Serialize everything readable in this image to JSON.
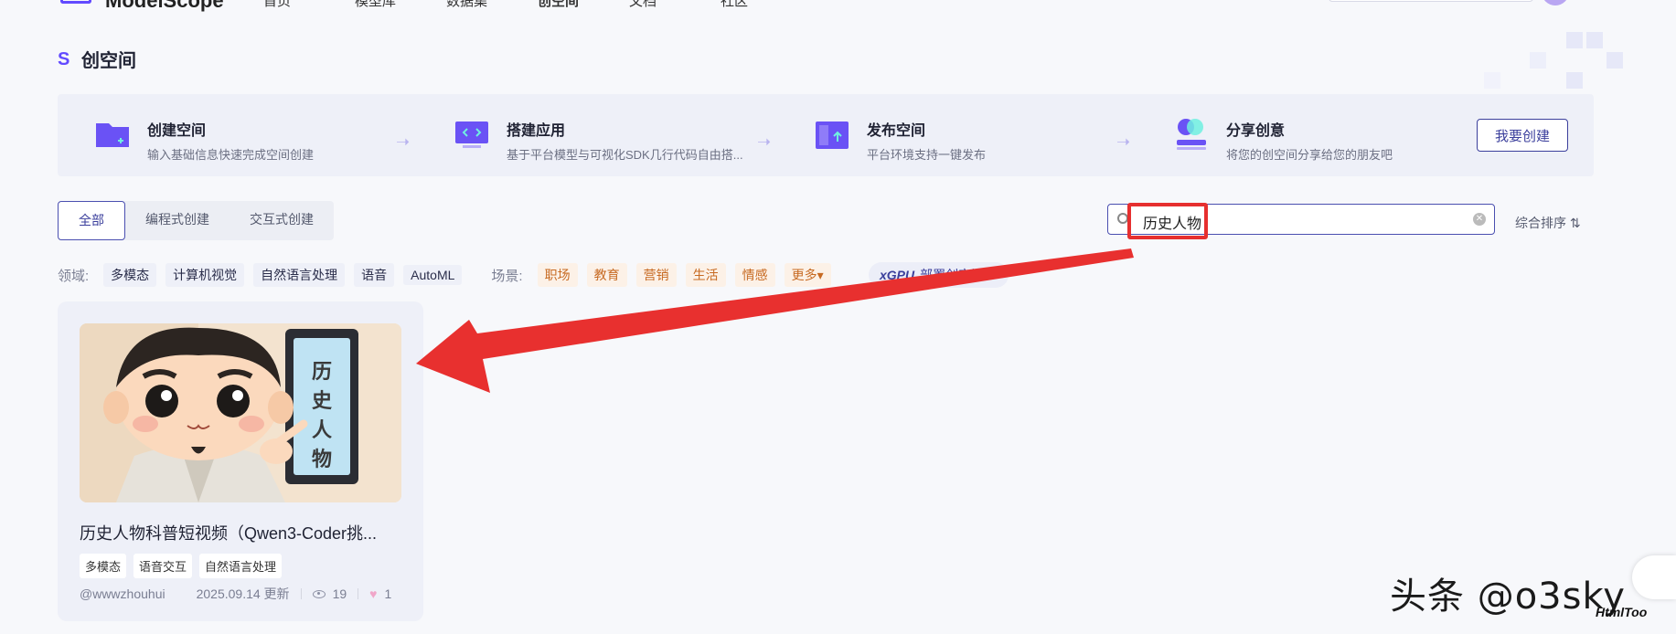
{
  "nav": {
    "logo": "ModelScope",
    "items": [
      "首页",
      "模型库",
      "数据集",
      "创空间",
      "文档",
      "社区"
    ],
    "active_index": 3
  },
  "page": {
    "title": "创空间"
  },
  "steps": [
    {
      "title": "创建空间",
      "desc": "输入基础信息快速完成空间创建",
      "icon": "folder-plus-icon"
    },
    {
      "title": "搭建应用",
      "desc": "基于平台模型与可视化SDK几行代码自由搭...",
      "icon": "code-window-icon"
    },
    {
      "title": "发布空间",
      "desc": "平台环境支持一键发布",
      "icon": "upload-icon"
    },
    {
      "title": "分享创意",
      "desc": "将您的创空间分享给您的朋友吧",
      "icon": "user-share-icon"
    }
  ],
  "create_button": "我要创建",
  "tabs": [
    {
      "label": "全部",
      "active": true
    },
    {
      "label": "编程式创建",
      "active": false
    },
    {
      "label": "交互式创建",
      "active": false
    }
  ],
  "search": {
    "value": "历史人物"
  },
  "sort_label": "综合排序 ⇅",
  "filters": {
    "domain_label": "领域:",
    "domains": [
      "多模态",
      "计算机视觉",
      "自然语言处理",
      "语音",
      "AutoML"
    ],
    "scene_label": "场景:",
    "scenes": [
      "职场",
      "教育",
      "营销",
      "生活",
      "情感",
      "更多▾"
    ],
    "gpu_badge": {
      "brand": "xGPU",
      "text": "部署创空间 ›"
    }
  },
  "card": {
    "image_text": "历史人物",
    "title": "历史人物科普短视频（Qwen3-Coder挑...",
    "tags": [
      "多模态",
      "语音交互",
      "自然语言处理"
    ],
    "author": "@wwwzhouhui",
    "updated": "2025.09.14 更新",
    "views": "19",
    "likes": "1"
  },
  "watermark": {
    "text": "头条 @o3sky",
    "logo": "HtmlToo"
  },
  "colors": {
    "accent": "#624aff",
    "primary_border": "#4a4fb0",
    "annotation_red": "#e62f2f",
    "scene_tag_text": "#c76a22"
  }
}
